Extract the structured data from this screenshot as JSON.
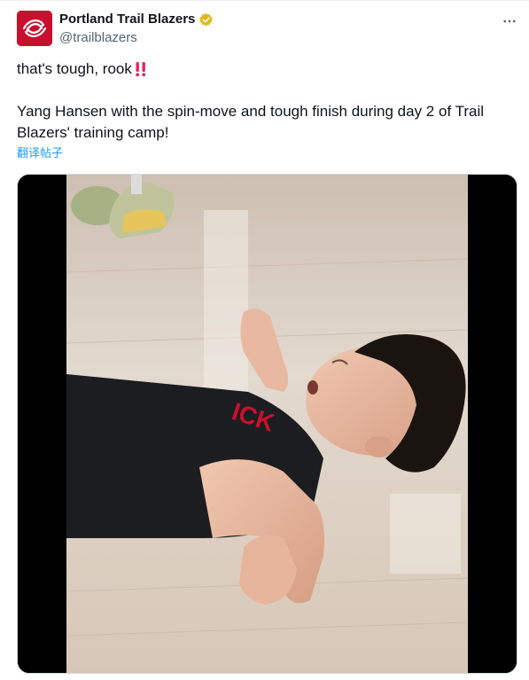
{
  "account": {
    "display_name": "Portland Trail Blazers",
    "handle": "@trailblazers",
    "brand_color": "#c8102e",
    "verified_color": "#e2b719"
  },
  "icons": {
    "avatar": "pinwheel-logo",
    "verified": "verified-badge-icon",
    "more": "more-horizontal-icon",
    "emoji": "double-exclamation-emoji"
  },
  "tweet": {
    "line1": "that's tough, rook",
    "line2": "Yang Hansen with the spin-move and tough finish during day 2 of Trail Blazers' training camp!",
    "translate_label": "翻译帖子"
  },
  "media": {
    "type": "video",
    "description_colors": {
      "floor": "#d9cfc3",
      "jersey": "#1b1d20",
      "skin": "#e8b9a0",
      "hair": "#1a1411"
    }
  }
}
